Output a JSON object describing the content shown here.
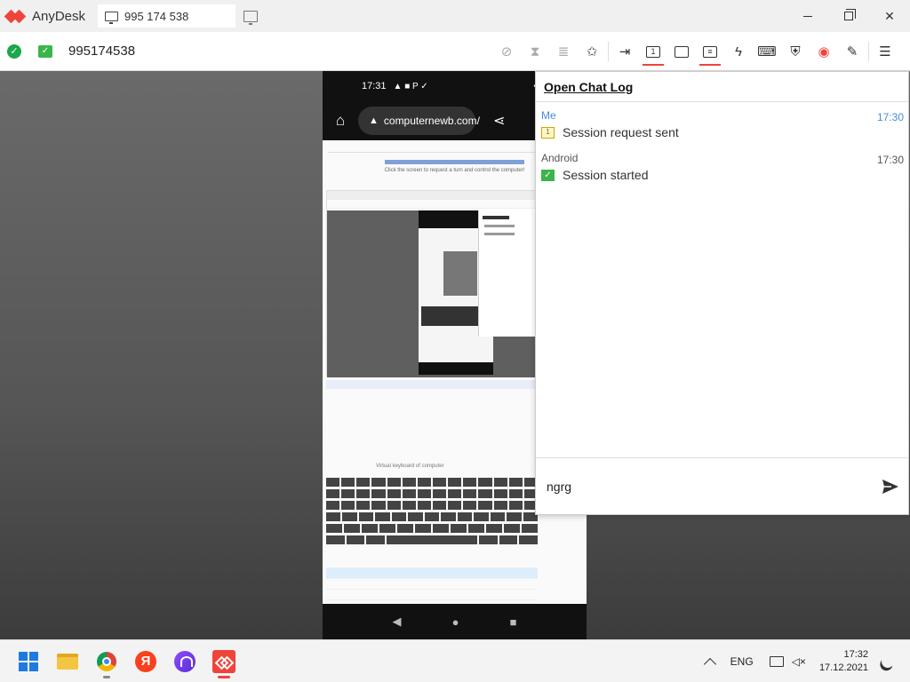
{
  "app": {
    "name": "AnyDesk"
  },
  "tab": {
    "label": "995 174 538"
  },
  "address": {
    "value": "995174538"
  },
  "window_controls": {
    "minimize": "minimize",
    "restore": "restore",
    "close": "close"
  },
  "toolbar": {
    "icons": [
      "privacy-icon",
      "hourglass-icon",
      "database-icon",
      "star-icon",
      "file-transfer-icon",
      "monitor-select-icon",
      "display-icon",
      "chat-icon",
      "actions-icon",
      "keyboard-icon",
      "permissions-icon",
      "record-icon",
      "whiteboard-icon",
      "menu-icon"
    ]
  },
  "remote": {
    "status_time": "17:31",
    "url": "computernewb.com/",
    "screen_text": "Click the screen to request a turn and control the computer!",
    "keyboard_label": "Virtual keyboard of computer"
  },
  "chat": {
    "title": "Open Chat Log",
    "messages": [
      {
        "sender": "Me",
        "time": "17:30",
        "text": "Session request sent"
      },
      {
        "sender": "Android",
        "time": "17:30",
        "text": "Session started"
      }
    ],
    "input_value": "ngrg"
  },
  "taskbar": {
    "yandex_letter": "Я",
    "lang": "ENG",
    "time": "17:32",
    "date": "17.12.2021"
  },
  "colors": {
    "accent": "#ef443b",
    "ok": "#1aa84a",
    "link_time": "#4a8ad8"
  }
}
